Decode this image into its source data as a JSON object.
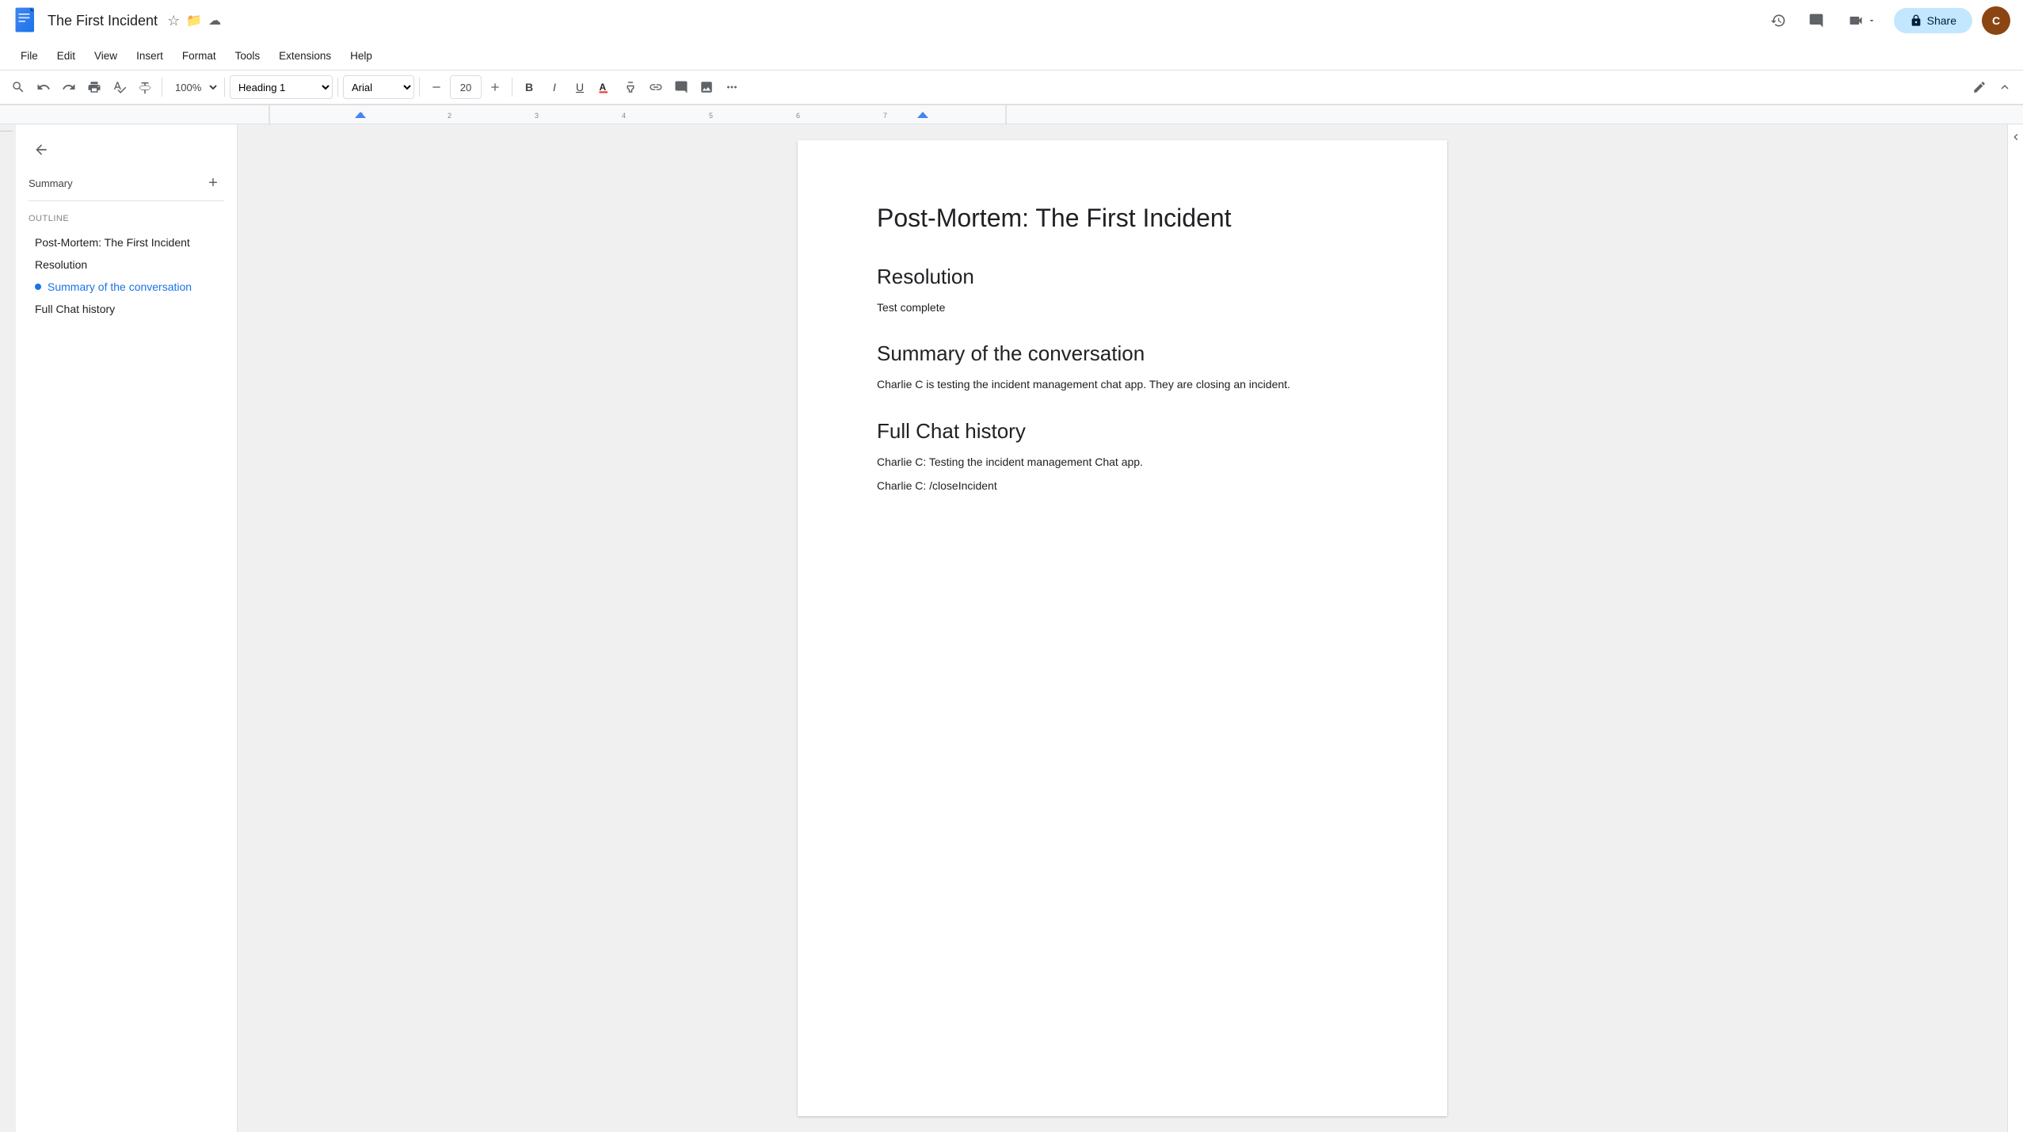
{
  "app": {
    "name": "Google Docs",
    "doc_title": "The First Incident"
  },
  "title_bar": {
    "title": "The First Incident",
    "star_icon": "★",
    "folder_icon": "📁",
    "cloud_icon": "☁",
    "share_label": "Share"
  },
  "menu": {
    "items": [
      "File",
      "Edit",
      "View",
      "Insert",
      "Format",
      "Tools",
      "Extensions",
      "Help"
    ]
  },
  "toolbar": {
    "zoom": "100%",
    "style": "Heading 1",
    "font": "Arial",
    "font_size": "20",
    "bold_label": "B",
    "italic_label": "I",
    "underline_label": "U"
  },
  "sidebar": {
    "back_icon": "←",
    "summary_label": "Summary",
    "add_icon": "+",
    "outline_label": "Outline",
    "outline_items": [
      {
        "id": "item-1",
        "label": "Post-Mortem: The First Incident",
        "active": false
      },
      {
        "id": "item-2",
        "label": "Resolution",
        "active": false
      },
      {
        "id": "item-3",
        "label": "Summary of the conversation",
        "active": true
      },
      {
        "id": "item-4",
        "label": "Full Chat history",
        "active": false
      }
    ]
  },
  "document": {
    "title": "Post-Mortem: The First Incident",
    "sections": [
      {
        "heading": "Resolution",
        "paragraphs": [
          "Test complete"
        ]
      },
      {
        "heading": "Summary of the conversation",
        "paragraphs": [
          "Charlie C is testing the incident management chat app. They are closing an incident."
        ]
      },
      {
        "heading": "Full Chat history",
        "paragraphs": [
          "Charlie C: Testing the incident management Chat app.",
          "Charlie C: /closeIncident"
        ]
      }
    ]
  },
  "icons": {
    "search": "🔍",
    "undo": "↩",
    "redo": "↪",
    "print": "🖨",
    "paintformat": "🖌",
    "spellcheck": "✓",
    "minus": "−",
    "plus": "+",
    "more": "⋯",
    "pencil": "✏",
    "collapse": "⌃",
    "history": "🕐",
    "comment": "💬",
    "video": "📹",
    "lock": "🔒"
  }
}
